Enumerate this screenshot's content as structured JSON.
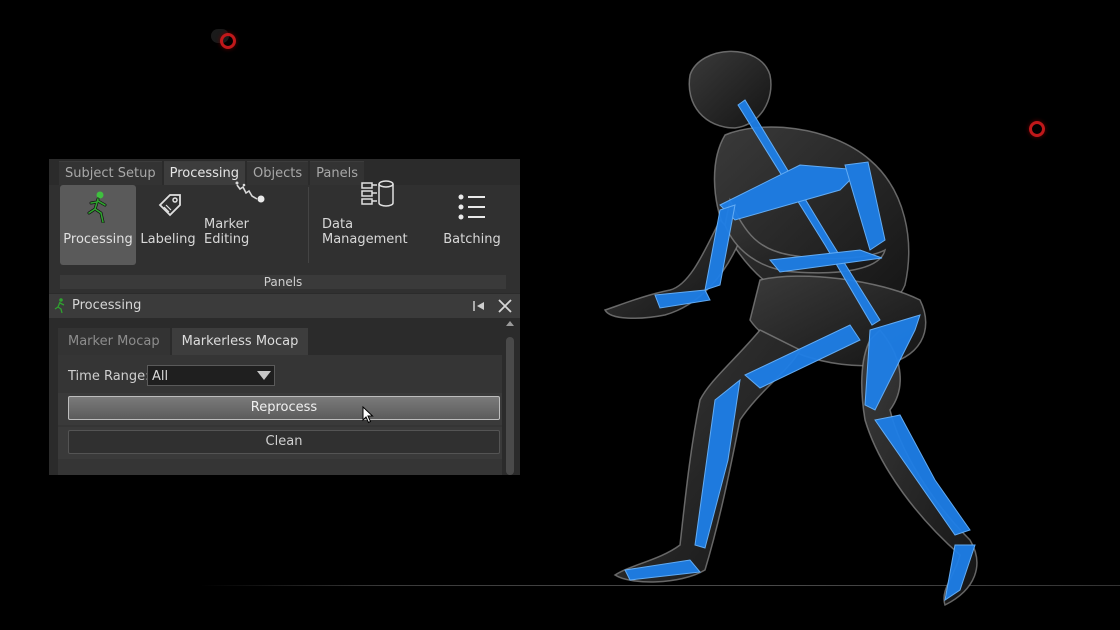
{
  "ribbon": {
    "tabs": [
      "Subject Setup",
      "Processing",
      "Objects",
      "Panels"
    ],
    "active_tab": "Processing",
    "tools": [
      {
        "label": "Processing",
        "icon": "running-figure-icon",
        "active": true
      },
      {
        "label": "Labeling",
        "icon": "tag-icon",
        "active": false
      },
      {
        "label": "Marker Editing",
        "icon": "marker-editing-icon",
        "active": false
      },
      {
        "label": "Data Management",
        "icon": "data-management-icon",
        "active": false
      },
      {
        "label": "Batching",
        "icon": "list-icon",
        "active": false
      }
    ],
    "footer": "Panels"
  },
  "processing_panel": {
    "title": "Processing",
    "sub_tabs": [
      "Marker Mocap",
      "Markerless Mocap"
    ],
    "active_sub_tab": "Markerless Mocap",
    "time_range": {
      "label": "Time Range:",
      "value": "All"
    },
    "buttons": {
      "reprocess": "Reprocess",
      "clean": "Clean"
    }
  },
  "colors": {
    "bone_blue": "#1e7fe8",
    "marker_red": "#c0181a",
    "panel_bg": "#2b2b2b"
  }
}
